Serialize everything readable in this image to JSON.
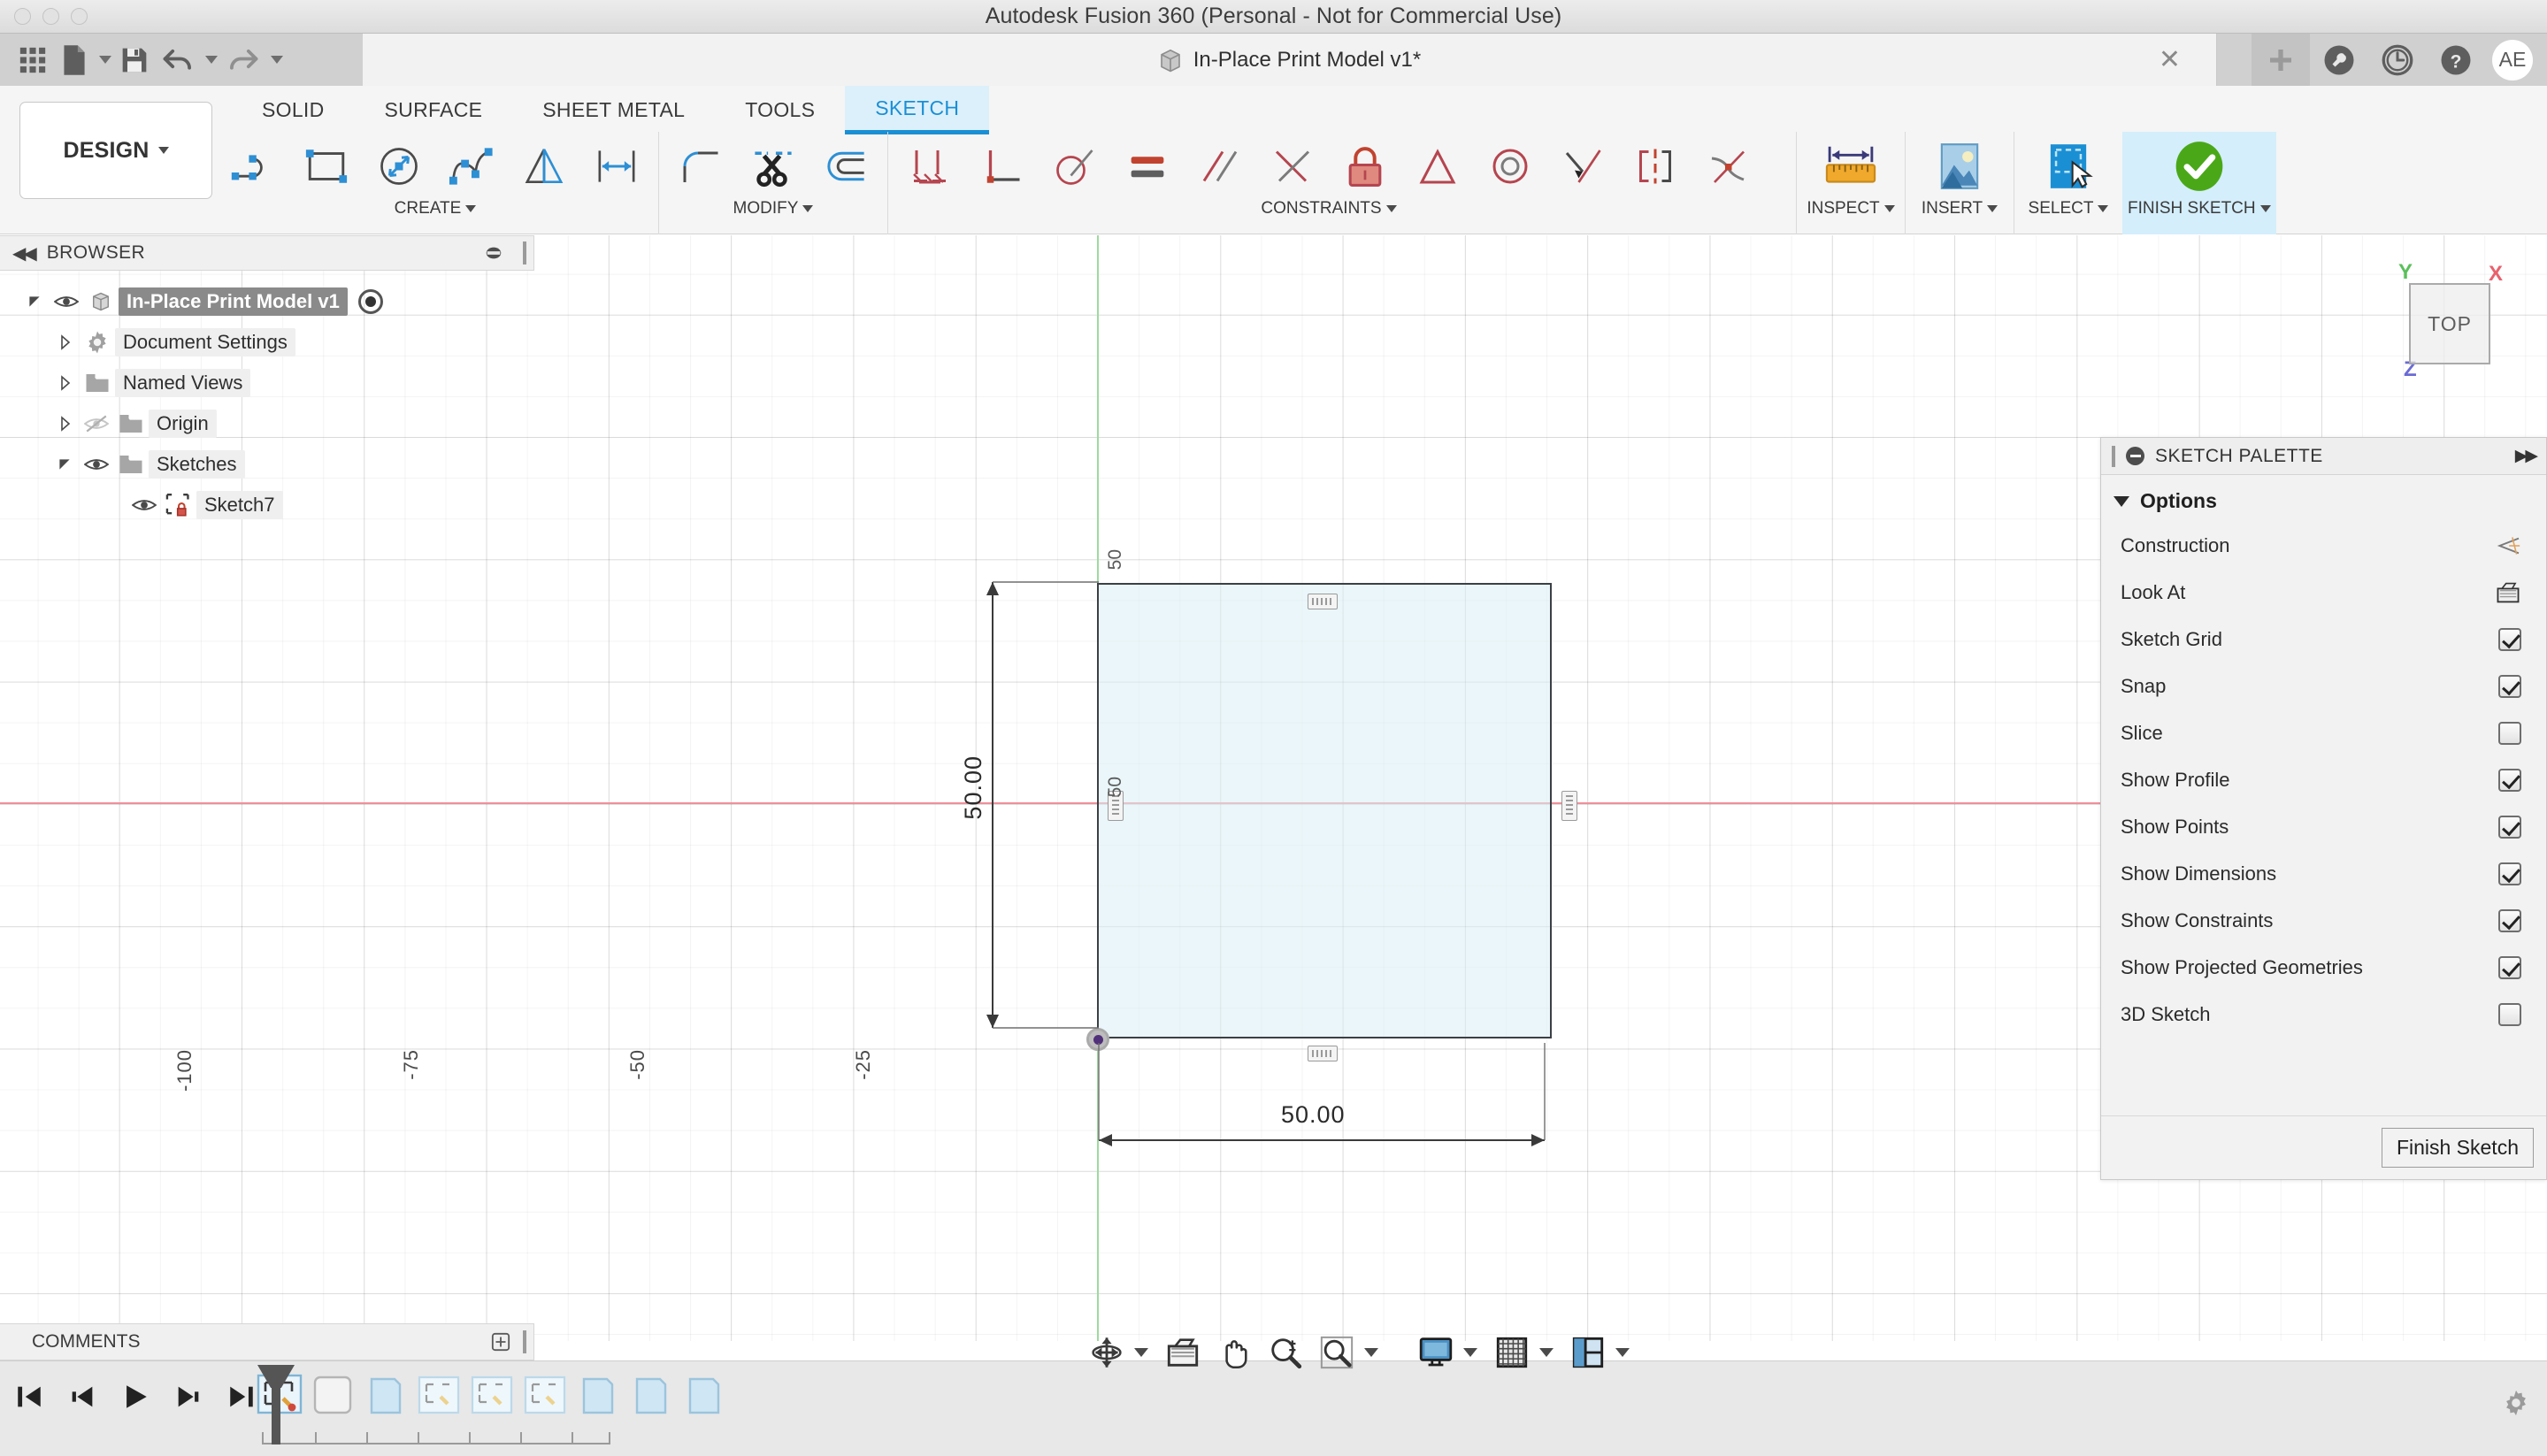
{
  "window": {
    "title": "Autodesk Fusion 360 (Personal - Not for Commercial Use)",
    "traffic_lights": [
      "close",
      "minimize",
      "zoom"
    ]
  },
  "appbar": {
    "quick_access": [
      {
        "name": "grid-apps-icon",
        "label": "Show Data Panel"
      },
      {
        "name": "new-file-icon",
        "label": "File"
      },
      {
        "name": "save-icon",
        "label": "Save"
      },
      {
        "name": "undo-icon",
        "label": "Undo"
      },
      {
        "name": "redo-icon",
        "label": "Redo"
      }
    ],
    "document_tab": {
      "title": "In-Place Print Model v1*",
      "close_label": "✕"
    },
    "right_icons": [
      {
        "name": "plus-icon",
        "label": "New Design"
      },
      {
        "name": "wrench-icon",
        "label": "Tools"
      },
      {
        "name": "clock-icon",
        "label": "Job Status"
      },
      {
        "name": "help-icon",
        "label": "Help"
      }
    ],
    "avatar_initials": "AE"
  },
  "ribbon": {
    "workspace_label": "DESIGN",
    "tabs": [
      {
        "label": "SOLID",
        "active": false
      },
      {
        "label": "SURFACE",
        "active": false
      },
      {
        "label": "SHEET METAL",
        "active": false
      },
      {
        "label": "TOOLS",
        "active": false
      },
      {
        "label": "SKETCH",
        "active": true
      }
    ],
    "panels": [
      {
        "label": "CREATE",
        "tools": [
          "line-icon",
          "rectangle-icon",
          "circle-icon",
          "spline-icon",
          "mirror-icon",
          "sketch-dimension-icon"
        ]
      },
      {
        "label": "MODIFY",
        "tools": [
          "fillet-icon",
          "trim-scissors-icon",
          "offset-icon"
        ]
      },
      {
        "label": "CONSTRAINTS",
        "tools": [
          "coincident-icon",
          "perpendicular-icon",
          "tangent-icon",
          "equal-icon",
          "parallel-icon",
          "midpoint-icon",
          "fix-lock-icon",
          "horizontal-vertical-icon",
          "concentric-icon",
          "collinear-icon",
          "symmetry-icon",
          "curvature-icon"
        ]
      },
      {
        "label": "INSPECT",
        "tools": [
          "measure-icon"
        ]
      },
      {
        "label": "INSERT",
        "tools": [
          "insert-image-icon"
        ]
      },
      {
        "label": "SELECT",
        "tools": [
          "select-cursor-icon"
        ]
      },
      {
        "label": "FINISH SKETCH",
        "tools": [
          "finish-sketch-check-icon"
        ]
      }
    ]
  },
  "browser": {
    "header_label": "BROWSER",
    "tree": [
      {
        "label": "In-Place Print Model v1",
        "depth": 0,
        "expander": "open",
        "eye": true,
        "icon": "component-icon",
        "selected": true,
        "radio": true
      },
      {
        "label": "Document Settings",
        "depth": 1,
        "expander": "closed",
        "eye": false,
        "icon": "gear-icon",
        "selected": false,
        "radio": false
      },
      {
        "label": "Named Views",
        "depth": 1,
        "expander": "closed",
        "eye": false,
        "icon": "folder-icon",
        "selected": false,
        "radio": false
      },
      {
        "label": "Origin",
        "depth": 1,
        "expander": "closed",
        "eye": "hidden",
        "icon": "folder-icon",
        "selected": false,
        "radio": false
      },
      {
        "label": "Sketches",
        "depth": 1,
        "expander": "open",
        "eye": true,
        "icon": "folder-icon",
        "selected": false,
        "radio": false
      },
      {
        "label": "Sketch7",
        "depth": 2,
        "expander": "none",
        "eye": true,
        "icon": "sketch-locked-icon",
        "selected": false,
        "radio": false
      }
    ],
    "comments_label": "COMMENTS"
  },
  "canvas": {
    "x_axis_ticks": [
      "-100",
      "-75",
      "-50",
      "-25"
    ],
    "dimensions": {
      "vertical": "50.00",
      "horizontal": "50.00",
      "edge_top": "50",
      "edge_left": "50"
    },
    "constraint_markers": [
      "horizontal-constraint-top",
      "horizontal-constraint-bottom",
      "vertical-constraint-left",
      "vertical-constraint-right"
    ],
    "viewcube": {
      "face_label": "TOP",
      "axes": [
        {
          "label": "X",
          "color": "#e8616e"
        },
        {
          "label": "Y",
          "color": "#5bbf5b"
        },
        {
          "label": "Z",
          "color": "#6a6ad6"
        }
      ]
    },
    "colors": {
      "x_axis": "#f08f9a",
      "y_axis": "#9ed99e",
      "profile_fill": "#d8eef4",
      "profile_stroke": "#3b4045",
      "origin_point": "#51307a"
    }
  },
  "sketch_palette": {
    "header_label": "SKETCH PALETTE",
    "section_label": "Options",
    "options": [
      {
        "label": "Construction",
        "control": "icon",
        "icon": "construction-icon",
        "checked": null
      },
      {
        "label": "Look At",
        "control": "icon",
        "icon": "look-at-icon",
        "checked": null
      },
      {
        "label": "Sketch Grid",
        "control": "checkbox",
        "icon": null,
        "checked": true
      },
      {
        "label": "Snap",
        "control": "checkbox",
        "icon": null,
        "checked": true
      },
      {
        "label": "Slice",
        "control": "checkbox",
        "icon": null,
        "checked": false
      },
      {
        "label": "Show Profile",
        "control": "checkbox",
        "icon": null,
        "checked": true
      },
      {
        "label": "Show Points",
        "control": "checkbox",
        "icon": null,
        "checked": true
      },
      {
        "label": "Show Dimensions",
        "control": "checkbox",
        "icon": null,
        "checked": true
      },
      {
        "label": "Show Constraints",
        "control": "checkbox",
        "icon": null,
        "checked": true
      },
      {
        "label": "Show Projected Geometries",
        "control": "checkbox",
        "icon": null,
        "checked": true
      },
      {
        "label": "3D Sketch",
        "control": "checkbox",
        "icon": null,
        "checked": false
      }
    ],
    "finish_button_label": "Finish Sketch"
  },
  "navigation_bar": {
    "buttons": [
      {
        "name": "orbit-icon",
        "label": "Orbit",
        "has_caret": true
      },
      {
        "name": "look-at-icon",
        "label": "Look At",
        "has_caret": false
      },
      {
        "name": "pan-hand-icon",
        "label": "Pan",
        "has_caret": false
      },
      {
        "name": "zoom-magnifier-icon",
        "label": "Zoom",
        "has_caret": false
      },
      {
        "name": "fit-window-icon",
        "label": "Fit",
        "has_caret": true
      },
      {
        "name": "display-settings-icon",
        "label": "Display Settings",
        "has_caret": true
      },
      {
        "name": "grid-snaps-icon",
        "label": "Grid and Snaps",
        "has_caret": true
      },
      {
        "name": "viewports-icon",
        "label": "Viewports",
        "has_caret": true
      }
    ]
  },
  "timeline": {
    "controls": [
      {
        "name": "jump-start-icon",
        "label": "Go to beginning"
      },
      {
        "name": "step-back-icon",
        "label": "Step back"
      },
      {
        "name": "play-icon",
        "label": "Play"
      },
      {
        "name": "step-forward-icon",
        "label": "Step forward"
      },
      {
        "name": "jump-end-icon",
        "label": "Go to end"
      }
    ],
    "features": [
      {
        "name": "sketch-feature",
        "active": true
      },
      {
        "name": "extrude-feature",
        "active": false
      },
      {
        "name": "body-feature",
        "active": false
      },
      {
        "name": "sketch-feature-2",
        "active": false
      },
      {
        "name": "sketch-feature-3",
        "active": false
      },
      {
        "name": "sketch-feature-4",
        "active": false
      },
      {
        "name": "body-feature-2",
        "active": false
      },
      {
        "name": "body-feature-3",
        "active": false
      },
      {
        "name": "body-feature-4",
        "active": false
      }
    ],
    "settings_icon": "gear-icon"
  }
}
